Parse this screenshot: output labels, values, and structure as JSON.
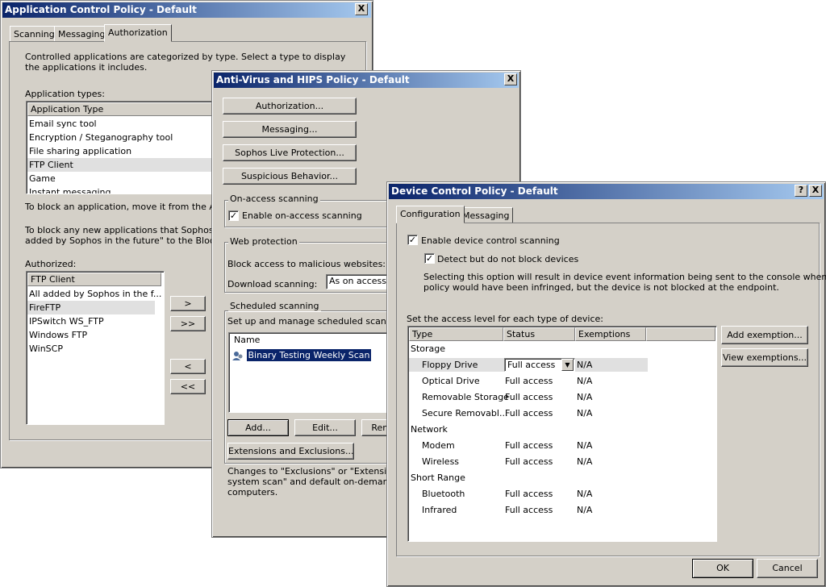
{
  "app_win": {
    "title": "Application Control Policy - Default",
    "close": "X",
    "tabs": [
      "Scanning",
      "Messaging",
      "Authorization"
    ],
    "intro": "Controlled applications are categorized by type. Select a type to display the applications it includes.",
    "types_label": "Application types:",
    "types_header": "Application Type",
    "types": [
      "Email sync tool",
      "Encryption / Steganography tool",
      "File sharing application",
      "FTP Client",
      "Game",
      "Instant messaging"
    ],
    "block_note1": "To block an application, move it from the Authori",
    "block_note2": "To block any new applications that Sophos adds",
    "block_note3": "added by Sophos in the future\" to the Blocked lis",
    "authorized_label": "Authorized:",
    "authorized_header": "FTP Client",
    "authorized": [
      "All added by Sophos in the f...",
      "FireFTP",
      "IPSwitch WS_FTP",
      "Windows FTP",
      "WinSCP"
    ],
    "move_right": ">",
    "move_all_right": ">>",
    "move_left": "<",
    "move_all_left": "<<"
  },
  "av_win": {
    "title": "Anti-Virus and HIPS Policy - Default",
    "close": "X",
    "btn_authorization": "Authorization...",
    "btn_messaging": "Messaging...",
    "btn_live": "Sophos Live Protection...",
    "btn_suspicious": "Suspicious Behavior...",
    "onaccess_label": "On-access scanning",
    "onaccess_check": "Enable on-access scanning",
    "web_label": "Web protection",
    "web_block": "Block access to malicious websites:",
    "web_download": "Download scanning:",
    "web_download_value": "As on access",
    "sched_label": "Scheduled scanning",
    "sched_desc": "Set up and manage scheduled scans:",
    "sched_header": "Name",
    "sched_item": "Binary Testing Weekly Scan",
    "btn_add": "Add...",
    "btn_edit": "Edit...",
    "btn_remove": "Rem",
    "btn_ext": "Extensions and Exclusions...",
    "changes1": "Changes to \"Exclusions\" or \"Extensions\" s",
    "changes2": "system scan\" and default on-demand sca",
    "changes3": "computers."
  },
  "dc_win": {
    "title": "Device Control Policy - Default",
    "help": "?",
    "close": "X",
    "tabs": [
      "Configuration",
      "Messaging"
    ],
    "enable_scan": "Enable device control scanning",
    "detect_only": "Detect but do not block devices",
    "detect_note1": "Selecting this option will result in device event information being sent to the console when the",
    "detect_note2": "policy would have been infringed, but the device is not blocked at the endpoint.",
    "access_label": "Set the access level for each type of device:",
    "columns": [
      "Type",
      "Status",
      "Exemptions"
    ],
    "groups": [
      {
        "name": "Storage",
        "rows": [
          {
            "type": "Floppy Drive",
            "status": "Full access",
            "exemptions": "N/A"
          },
          {
            "type": "Optical Drive",
            "status": "Full access",
            "exemptions": "N/A"
          },
          {
            "type": "Removable Storage",
            "status": "Full access",
            "exemptions": "N/A"
          },
          {
            "type": "Secure Removabl...",
            "status": "Full access",
            "exemptions": "N/A"
          }
        ]
      },
      {
        "name": "Network",
        "rows": [
          {
            "type": "Modem",
            "status": "Full access",
            "exemptions": "N/A"
          },
          {
            "type": "Wireless",
            "status": "Full access",
            "exemptions": "N/A"
          }
        ]
      },
      {
        "name": "Short Range",
        "rows": [
          {
            "type": "Bluetooth",
            "status": "Full access",
            "exemptions": "N/A"
          },
          {
            "type": "Infrared",
            "status": "Full access",
            "exemptions": "N/A"
          }
        ]
      }
    ],
    "btn_add_exemption": "Add exemption...",
    "btn_view_exemptions": "View exemptions...",
    "btn_ok": "OK",
    "btn_cancel": "Cancel"
  }
}
